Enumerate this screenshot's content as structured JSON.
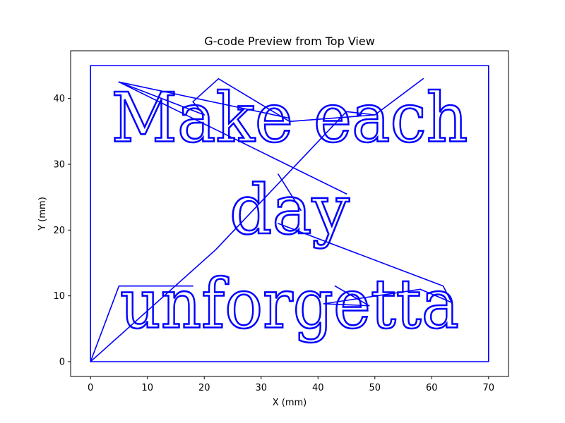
{
  "chart_data": {
    "type": "line",
    "title": "G-code Preview from Top View",
    "xlabel": "X (mm)",
    "ylabel": "Y (mm)",
    "xlim": [
      -3.5,
      73.5
    ],
    "ylim": [
      -2.25,
      47.25
    ],
    "xticks": [
      0,
      10,
      20,
      30,
      40,
      50,
      60,
      70
    ],
    "yticks": [
      0,
      10,
      20,
      30,
      40
    ],
    "grid": false,
    "color": "#0000ff",
    "text_lines": [
      {
        "text": "Make each",
        "x": 35,
        "y": 33.5
      },
      {
        "text": "day",
        "x": 35,
        "y": 19.5
      },
      {
        "text": "unforgetta",
        "x": 35,
        "y": 5.2
      }
    ],
    "series": [
      {
        "values": [
          [
            0,
            0
          ],
          [
            70,
            0
          ],
          [
            70,
            45
          ],
          [
            0,
            45
          ],
          [
            0,
            0
          ]
        ]
      },
      {
        "values": [
          [
            0,
            0
          ],
          [
            5,
            11.5
          ],
          [
            18,
            11.5
          ]
        ]
      },
      {
        "values": [
          [
            0,
            0
          ],
          [
            22,
            17
          ],
          [
            45,
            38
          ],
          [
            50,
            37.5
          ],
          [
            58.5,
            43
          ]
        ]
      },
      {
        "values": [
          [
            5,
            42.5
          ],
          [
            20,
            37.5
          ],
          [
            18,
            39.5
          ],
          [
            22.5,
            43
          ],
          [
            35,
            36.5
          ],
          [
            50,
            37.5
          ]
        ]
      },
      {
        "values": [
          [
            5,
            42.5
          ],
          [
            45,
            25.5
          ]
        ]
      },
      {
        "values": [
          [
            5,
            42.5
          ],
          [
            35,
            37
          ]
        ]
      },
      {
        "values": [
          [
            33,
            28.5
          ],
          [
            37,
            23
          ]
        ]
      },
      {
        "values": [
          [
            33,
            21
          ],
          [
            62,
            11.5
          ],
          [
            63.5,
            9
          ]
        ]
      },
      {
        "values": [
          [
            43,
            11.5
          ],
          [
            49,
            8.5
          ],
          [
            41,
            8.8
          ],
          [
            58,
            11
          ],
          [
            63.5,
            9
          ]
        ]
      }
    ]
  }
}
